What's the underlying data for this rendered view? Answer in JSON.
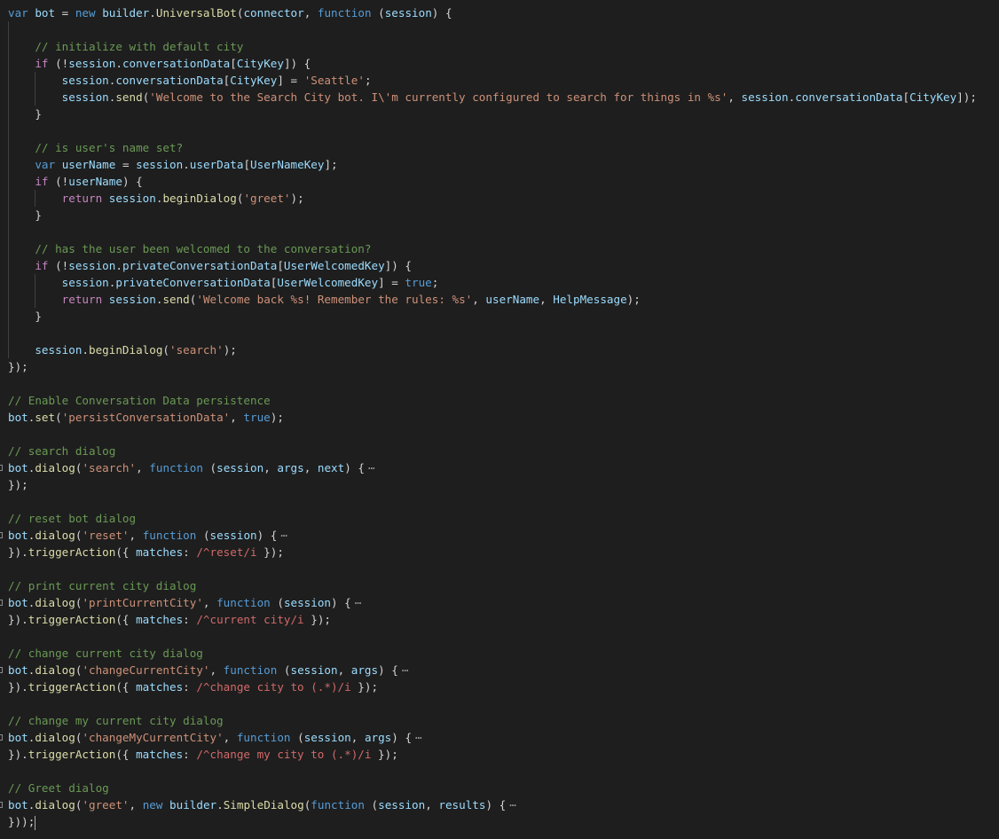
{
  "editor": {
    "colors": {
      "background": "#1e1e1e",
      "default": "#d4d4d4",
      "keyword": "#569cd6",
      "control": "#c586c0",
      "string": "#ce9178",
      "comment": "#6a9955",
      "variable": "#9cdcfe",
      "function": "#dcdcaa",
      "type": "#4ec9b0",
      "regex": "#d16969"
    },
    "fold_ellipsis": "⋯",
    "lines": [
      [
        [
          "kw",
          "var"
        ],
        [
          "p",
          " "
        ],
        [
          "var",
          "bot"
        ],
        [
          "p",
          " = "
        ],
        [
          "kw",
          "new"
        ],
        [
          "p",
          " "
        ],
        [
          "var",
          "builder"
        ],
        [
          "p",
          "."
        ],
        [
          "fn",
          "UniversalBot"
        ],
        [
          "p",
          "("
        ],
        [
          "var",
          "connector"
        ],
        [
          "p",
          ", "
        ],
        [
          "kw",
          "function"
        ],
        [
          "p",
          " ("
        ],
        [
          "var",
          "session"
        ],
        [
          "p",
          ") {"
        ]
      ],
      [],
      [
        [
          "p",
          "    "
        ],
        [
          "cmt",
          "// initialize with default city"
        ]
      ],
      [
        [
          "p",
          "    "
        ],
        [
          "ctl",
          "if"
        ],
        [
          "p",
          " (!"
        ],
        [
          "var",
          "session"
        ],
        [
          "p",
          "."
        ],
        [
          "var",
          "conversationData"
        ],
        [
          "p",
          "["
        ],
        [
          "var",
          "CityKey"
        ],
        [
          "p",
          "]) {"
        ]
      ],
      [
        [
          "p",
          "        "
        ],
        [
          "var",
          "session"
        ],
        [
          "p",
          "."
        ],
        [
          "var",
          "conversationData"
        ],
        [
          "p",
          "["
        ],
        [
          "var",
          "CityKey"
        ],
        [
          "p",
          "] = "
        ],
        [
          "str",
          "'Seattle'"
        ],
        [
          "p",
          ";"
        ]
      ],
      [
        [
          "p",
          "        "
        ],
        [
          "var",
          "session"
        ],
        [
          "p",
          "."
        ],
        [
          "fn",
          "send"
        ],
        [
          "p",
          "("
        ],
        [
          "str",
          "'Welcome to the Search City bot. I\\'m currently configured to search for things in %s'"
        ],
        [
          "p",
          ", "
        ],
        [
          "var",
          "session"
        ],
        [
          "p",
          "."
        ],
        [
          "var",
          "conversationData"
        ],
        [
          "p",
          "["
        ],
        [
          "var",
          "CityKey"
        ],
        [
          "p",
          "]);"
        ]
      ],
      [
        [
          "p",
          "    }"
        ]
      ],
      [],
      [
        [
          "p",
          "    "
        ],
        [
          "cmt",
          "// is user's name set?"
        ]
      ],
      [
        [
          "p",
          "    "
        ],
        [
          "kw",
          "var"
        ],
        [
          "p",
          " "
        ],
        [
          "var",
          "userName"
        ],
        [
          "p",
          " = "
        ],
        [
          "var",
          "session"
        ],
        [
          "p",
          "."
        ],
        [
          "var",
          "userData"
        ],
        [
          "p",
          "["
        ],
        [
          "var",
          "UserNameKey"
        ],
        [
          "p",
          "];"
        ]
      ],
      [
        [
          "p",
          "    "
        ],
        [
          "ctl",
          "if"
        ],
        [
          "p",
          " (!"
        ],
        [
          "var",
          "userName"
        ],
        [
          "p",
          ") {"
        ]
      ],
      [
        [
          "p",
          "        "
        ],
        [
          "ctl",
          "return"
        ],
        [
          "p",
          " "
        ],
        [
          "var",
          "session"
        ],
        [
          "p",
          "."
        ],
        [
          "fn",
          "beginDialog"
        ],
        [
          "p",
          "("
        ],
        [
          "str",
          "'greet'"
        ],
        [
          "p",
          ");"
        ]
      ],
      [
        [
          "p",
          "    }"
        ]
      ],
      [],
      [
        [
          "p",
          "    "
        ],
        [
          "cmt",
          "// has the user been welcomed to the conversation?"
        ]
      ],
      [
        [
          "p",
          "    "
        ],
        [
          "ctl",
          "if"
        ],
        [
          "p",
          " (!"
        ],
        [
          "var",
          "session"
        ],
        [
          "p",
          "."
        ],
        [
          "var",
          "privateConversationData"
        ],
        [
          "p",
          "["
        ],
        [
          "var",
          "UserWelcomedKey"
        ],
        [
          "p",
          "]) {"
        ]
      ],
      [
        [
          "p",
          "        "
        ],
        [
          "var",
          "session"
        ],
        [
          "p",
          "."
        ],
        [
          "var",
          "privateConversationData"
        ],
        [
          "p",
          "["
        ],
        [
          "var",
          "UserWelcomedKey"
        ],
        [
          "p",
          "] = "
        ],
        [
          "kw",
          "true"
        ],
        [
          "p",
          ";"
        ]
      ],
      [
        [
          "p",
          "        "
        ],
        [
          "ctl",
          "return"
        ],
        [
          "p",
          " "
        ],
        [
          "var",
          "session"
        ],
        [
          "p",
          "."
        ],
        [
          "fn",
          "send"
        ],
        [
          "p",
          "("
        ],
        [
          "str",
          "'Welcome back %s! Remember the rules: %s'"
        ],
        [
          "p",
          ", "
        ],
        [
          "var",
          "userName"
        ],
        [
          "p",
          ", "
        ],
        [
          "var",
          "HelpMessage"
        ],
        [
          "p",
          ");"
        ]
      ],
      [
        [
          "p",
          "    }"
        ]
      ],
      [],
      [
        [
          "p",
          "    "
        ],
        [
          "var",
          "session"
        ],
        [
          "p",
          "."
        ],
        [
          "fn",
          "beginDialog"
        ],
        [
          "p",
          "("
        ],
        [
          "str",
          "'search'"
        ],
        [
          "p",
          ");"
        ]
      ],
      [
        [
          "p",
          "});"
        ]
      ],
      [],
      [
        [
          "cmt",
          "// Enable Conversation Data persistence"
        ]
      ],
      [
        [
          "var",
          "bot"
        ],
        [
          "p",
          "."
        ],
        [
          "fn",
          "set"
        ],
        [
          "p",
          "("
        ],
        [
          "str",
          "'persistConversationData'"
        ],
        [
          "p",
          ", "
        ],
        [
          "kw",
          "true"
        ],
        [
          "p",
          ");"
        ]
      ],
      [],
      [
        [
          "cmt",
          "// search dialog"
        ]
      ],
      [
        [
          "var",
          "bot"
        ],
        [
          "p",
          "."
        ],
        [
          "fn",
          "dialog"
        ],
        [
          "p",
          "("
        ],
        [
          "str",
          "'search'"
        ],
        [
          "p",
          ", "
        ],
        [
          "kw",
          "function"
        ],
        [
          "p",
          " ("
        ],
        [
          "var",
          "session"
        ],
        [
          "p",
          ", "
        ],
        [
          "var",
          "args"
        ],
        [
          "p",
          ", "
        ],
        [
          "var",
          "next"
        ],
        [
          "p",
          ") {"
        ],
        [
          "fold",
          ""
        ]
      ],
      [
        [
          "p",
          "});"
        ]
      ],
      [],
      [
        [
          "cmt",
          "// reset bot dialog"
        ]
      ],
      [
        [
          "var",
          "bot"
        ],
        [
          "p",
          "."
        ],
        [
          "fn",
          "dialog"
        ],
        [
          "p",
          "("
        ],
        [
          "str",
          "'reset'"
        ],
        [
          "p",
          ", "
        ],
        [
          "kw",
          "function"
        ],
        [
          "p",
          " ("
        ],
        [
          "var",
          "session"
        ],
        [
          "p",
          ") {"
        ],
        [
          "fold",
          ""
        ]
      ],
      [
        [
          "p",
          "})."
        ],
        [
          "fn",
          "triggerAction"
        ],
        [
          "p",
          "({ "
        ],
        [
          "var",
          "matches"
        ],
        [
          "p",
          ": "
        ],
        [
          "rgx",
          "/^reset/i"
        ],
        [
          "p",
          " });"
        ]
      ],
      [],
      [
        [
          "cmt",
          "// print current city dialog"
        ]
      ],
      [
        [
          "var",
          "bot"
        ],
        [
          "p",
          "."
        ],
        [
          "fn",
          "dialog"
        ],
        [
          "p",
          "("
        ],
        [
          "str",
          "'printCurrentCity'"
        ],
        [
          "p",
          ", "
        ],
        [
          "kw",
          "function"
        ],
        [
          "p",
          " ("
        ],
        [
          "var",
          "session"
        ],
        [
          "p",
          ") {"
        ],
        [
          "fold",
          ""
        ]
      ],
      [
        [
          "p",
          "})."
        ],
        [
          "fn",
          "triggerAction"
        ],
        [
          "p",
          "({ "
        ],
        [
          "var",
          "matches"
        ],
        [
          "p",
          ": "
        ],
        [
          "rgx",
          "/^current city/i"
        ],
        [
          "p",
          " });"
        ]
      ],
      [],
      [
        [
          "cmt",
          "// change current city dialog"
        ]
      ],
      [
        [
          "var",
          "bot"
        ],
        [
          "p",
          "."
        ],
        [
          "fn",
          "dialog"
        ],
        [
          "p",
          "("
        ],
        [
          "str",
          "'changeCurrentCity'"
        ],
        [
          "p",
          ", "
        ],
        [
          "kw",
          "function"
        ],
        [
          "p",
          " ("
        ],
        [
          "var",
          "session"
        ],
        [
          "p",
          ", "
        ],
        [
          "var",
          "args"
        ],
        [
          "p",
          ") {"
        ],
        [
          "fold",
          ""
        ]
      ],
      [
        [
          "p",
          "})."
        ],
        [
          "fn",
          "triggerAction"
        ],
        [
          "p",
          "({ "
        ],
        [
          "var",
          "matches"
        ],
        [
          "p",
          ": "
        ],
        [
          "rgx",
          "/^change city to (.*)/i"
        ],
        [
          "p",
          " });"
        ]
      ],
      [],
      [
        [
          "cmt",
          "// change my current city dialog"
        ]
      ],
      [
        [
          "var",
          "bot"
        ],
        [
          "p",
          "."
        ],
        [
          "fn",
          "dialog"
        ],
        [
          "p",
          "("
        ],
        [
          "str",
          "'changeMyCurrentCity'"
        ],
        [
          "p",
          ", "
        ],
        [
          "kw",
          "function"
        ],
        [
          "p",
          " ("
        ],
        [
          "var",
          "session"
        ],
        [
          "p",
          ", "
        ],
        [
          "var",
          "args"
        ],
        [
          "p",
          ") {"
        ],
        [
          "fold",
          ""
        ]
      ],
      [
        [
          "p",
          "})."
        ],
        [
          "fn",
          "triggerAction"
        ],
        [
          "p",
          "({ "
        ],
        [
          "var",
          "matches"
        ],
        [
          "p",
          ": "
        ],
        [
          "rgx",
          "/^change my city to (.*)/i"
        ],
        [
          "p",
          " });"
        ]
      ],
      [],
      [
        [
          "cmt",
          "// Greet dialog"
        ]
      ],
      [
        [
          "var",
          "bot"
        ],
        [
          "p",
          "."
        ],
        [
          "fn",
          "dialog"
        ],
        [
          "p",
          "("
        ],
        [
          "str",
          "'greet'"
        ],
        [
          "p",
          ", "
        ],
        [
          "kw",
          "new"
        ],
        [
          "p",
          " "
        ],
        [
          "var",
          "builder"
        ],
        [
          "p",
          "."
        ],
        [
          "fn",
          "SimpleDialog"
        ],
        [
          "p",
          "("
        ],
        [
          "kw",
          "function"
        ],
        [
          "p",
          " ("
        ],
        [
          "var",
          "session"
        ],
        [
          "p",
          ", "
        ],
        [
          "var",
          "results"
        ],
        [
          "p",
          ") {"
        ],
        [
          "fold",
          ""
        ]
      ],
      [
        [
          "p",
          "}));"
        ],
        [
          "cursor",
          ""
        ]
      ]
    ]
  }
}
